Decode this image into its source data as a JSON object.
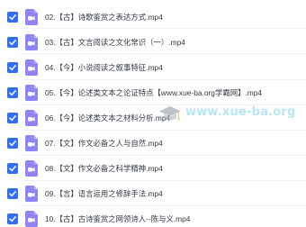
{
  "files": [
    {
      "name": "02.【古】诗歌鉴赏之表达方式.mp4"
    },
    {
      "name": "03.【古】文言阅读之文化常识（一）.mp4"
    },
    {
      "name": "04.【今】小说阅读之叙事特征.mp4"
    },
    {
      "name": "05.【今】论述类文本之论证特点【www.xue-ba.org学霸网】.mp4"
    },
    {
      "name": "06.【今】论述类文本之材料分析.mp4"
    },
    {
      "name": "07.【文】作文必备之人与自然.mp4"
    },
    {
      "name": "08.【文】作文必备之科学精神.mp4"
    },
    {
      "name": "09.【言】语言运用之修辞手法.mp4"
    },
    {
      "name": "10.【古】古诗鉴赏之网领诗人--陈与义.mp4"
    }
  ],
  "watermark": {
    "text": "www.xue-ba.org"
  },
  "icons": {
    "checkbox": "checkbox-checked-icon",
    "file": "video-file-icon"
  },
  "colors": {
    "checkbox": "#2f6ff0",
    "file_icon": "#8f84f0",
    "text": "#333a45",
    "watermark": "#7ed3e8"
  }
}
